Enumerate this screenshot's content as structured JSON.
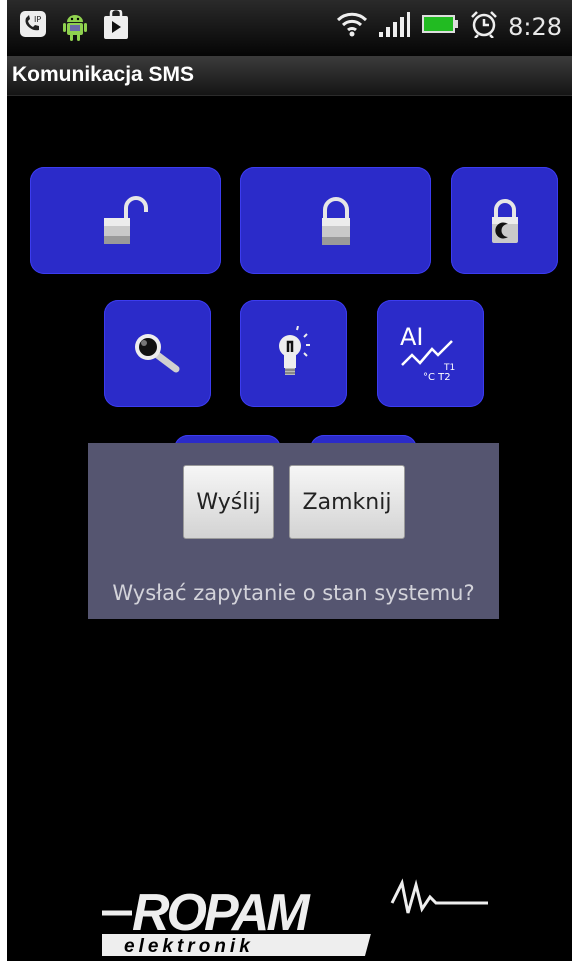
{
  "status_bar": {
    "time": "8:28",
    "left_icons": [
      "notification-app-icon",
      "android-icon",
      "play-store-icon"
    ],
    "right_icons": [
      "wifi-icon",
      "signal-icon",
      "battery-icon",
      "alarm-icon"
    ]
  },
  "title_bar": {
    "title": "Komunikacja SMS"
  },
  "actions": [
    {
      "icon": "unlock-icon"
    },
    {
      "icon": "lock-icon"
    },
    {
      "icon": "night-lock-icon"
    },
    {
      "icon": "magnifier-icon"
    },
    {
      "icon": "light-bulb-icon"
    },
    {
      "icon": "analog-input-icon",
      "icon_text": "AI",
      "icon_sub_1": "T1",
      "icon_sub_2": "°C T2"
    }
  ],
  "dialog": {
    "send_label": "Wyślij",
    "close_label": "Zamknij",
    "message": "Wysłać zapytanie o stan systemu?"
  },
  "logo": {
    "brand": "ROPAM",
    "sub": "elektronik"
  },
  "colors": {
    "button_blue": "#2b2bc9",
    "dialog_bg": "#555570"
  }
}
